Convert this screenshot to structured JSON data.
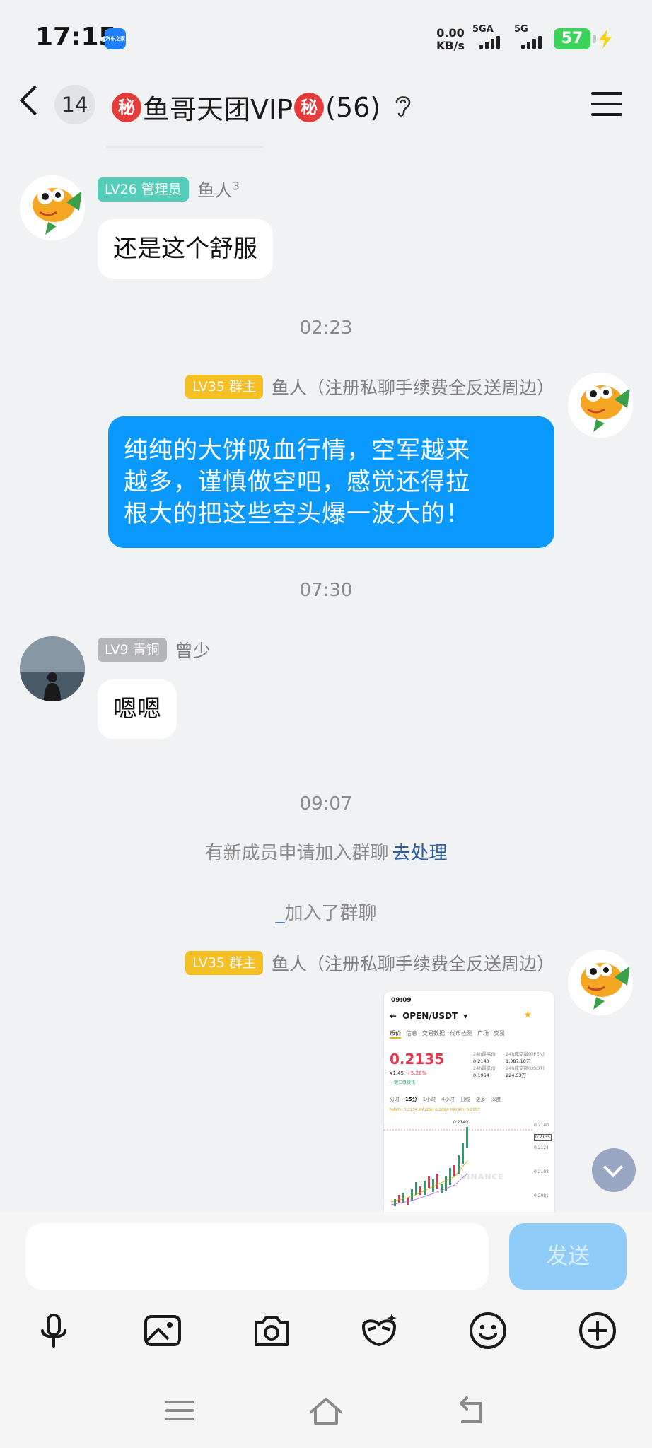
{
  "status_bar": {
    "time": "17:15",
    "app_badge": "汽车之家",
    "net_speed": "0.00",
    "net_unit": "KB/s",
    "sim1": "5GA",
    "sim2": "5G",
    "battery": "57"
  },
  "header": {
    "unread": "14",
    "secret_mark": "秘",
    "group_name": "鱼哥天团VIP",
    "member_count": "(56)"
  },
  "messages": {
    "m1": {
      "level": "LV26 管理员",
      "name": "鱼人",
      "name_sup": "3",
      "text": "还是这个舒服"
    },
    "t1": "02:23",
    "m2": {
      "level": "LV35 群主",
      "name": "鱼人（注册私聊手续费全反送周边）",
      "lines": [
        "纯纯的大饼吸血行情，空军越来",
        "越多，谨慎做空吧，感觉还得拉",
        "根大的把这些空头爆一波大的！"
      ]
    },
    "t2": "07:30",
    "m3": {
      "level": "LV9 青铜",
      "name": "曾少",
      "text": "嗯嗯"
    },
    "t3": "09:07",
    "sys1": {
      "text": "有新成员申请加入群聊",
      "action": "去处理"
    },
    "sys2": {
      "user": "_",
      "text": "加入了群聊"
    },
    "m4": {
      "level": "LV35 群主",
      "name": "鱼人（注册私聊手续费全反送周边）"
    }
  },
  "shared_image": {
    "time": "09:09",
    "pair": "OPEN/USDT",
    "tabs": [
      "币价",
      "信息",
      "交易数据",
      "代币检测",
      "广场",
      "交易"
    ],
    "price": "0.2135",
    "sub_price": "¥1.45",
    "change": "+5.26%",
    "tag": "一键二级资讯",
    "stat_labels": [
      "24h最高价",
      "24h最低价",
      "24h成交量(OPEN)",
      "24h成交额(USDT)"
    ],
    "stat_values": [
      "0.2140",
      "0.1964",
      "1,087.18万",
      "224.53万"
    ],
    "intervals": [
      "分时",
      "15分",
      "1小时",
      "4小时",
      "日线",
      "更多",
      "深度"
    ],
    "ma_line": "MA(7): 0.2134  MA(25): 0.2084  MA(99): 0.2057",
    "peak_label": "0.2140",
    "axis_labels": [
      "0.2140",
      "0.2135",
      "0.2124",
      "0.2103",
      "0.2081"
    ],
    "watermark": "BINANCE"
  },
  "input": {
    "send_label": "发送"
  },
  "toolbar_icons": [
    "microphone-icon",
    "image-icon",
    "camera-icon",
    "mask-icon",
    "emoji-icon",
    "plus-circle-icon"
  ],
  "nav_icons": [
    "menu-nav-icon",
    "home-nav-icon",
    "back-nav-icon"
  ]
}
